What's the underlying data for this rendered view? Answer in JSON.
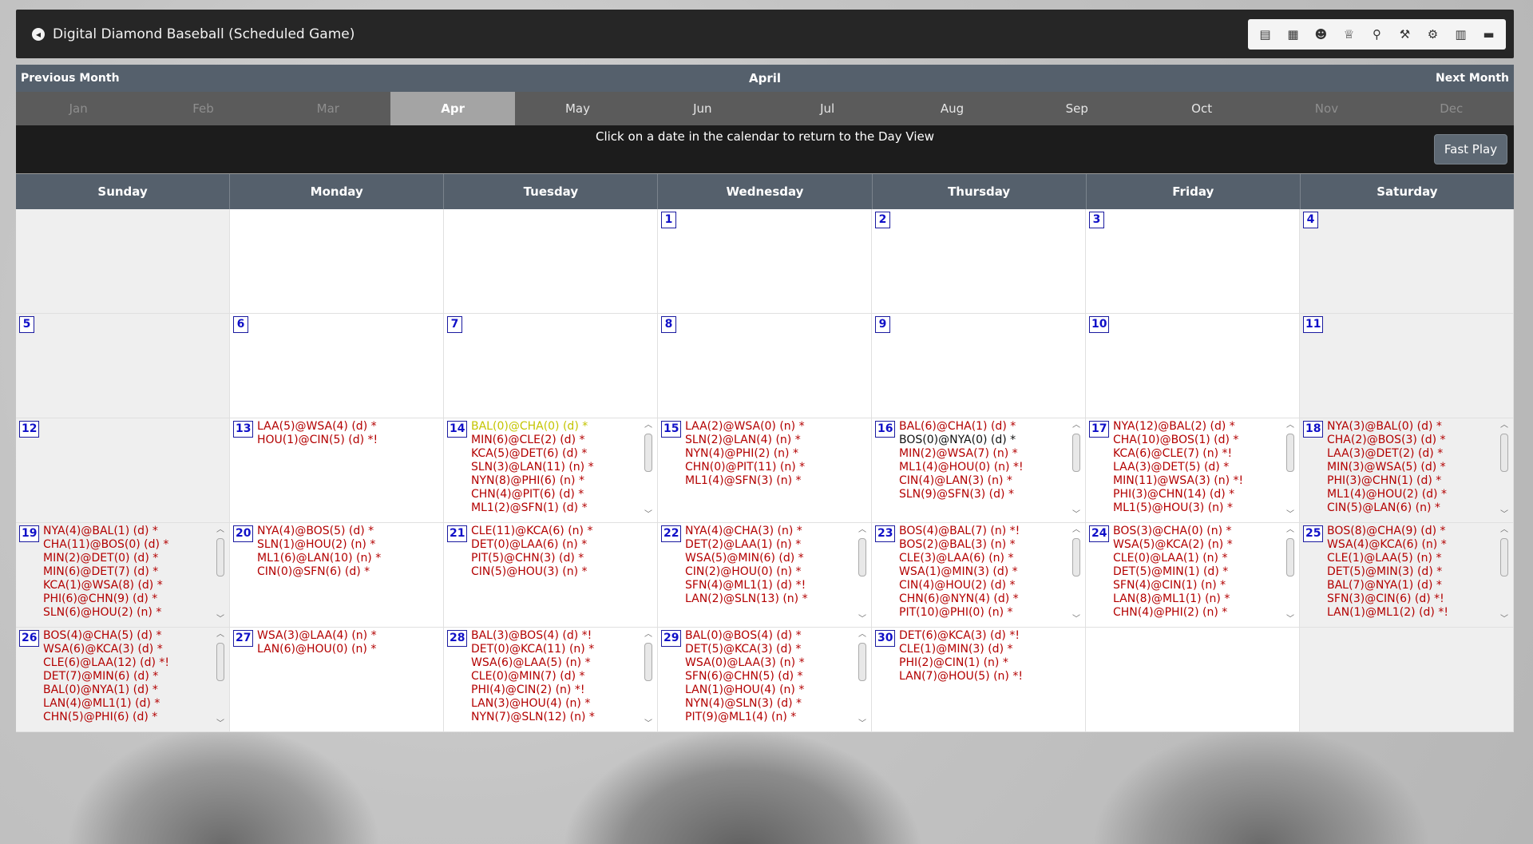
{
  "header": {
    "title": "Digital Diamond Baseball (Scheduled Game)"
  },
  "toolbar": [
    {
      "name": "document-icon",
      "glyph": "▤"
    },
    {
      "name": "grid-icon",
      "glyph": "▦"
    },
    {
      "name": "team-icon",
      "glyph": "☻"
    },
    {
      "name": "trophy-icon",
      "glyph": "♕"
    },
    {
      "name": "search-icon",
      "glyph": "⚲"
    },
    {
      "name": "gavel-icon",
      "glyph": "⚒"
    },
    {
      "name": "gear-icon",
      "glyph": "⚙"
    },
    {
      "name": "clipboard-icon",
      "glyph": "▥"
    },
    {
      "name": "folder-icon",
      "glyph": "▬"
    }
  ],
  "monthbar": {
    "prev": "Previous Month",
    "title": "April",
    "next": "Next Month"
  },
  "months": [
    {
      "label": "Jan",
      "state": "disabled"
    },
    {
      "label": "Feb",
      "state": "disabled"
    },
    {
      "label": "Mar",
      "state": "disabled"
    },
    {
      "label": "Apr",
      "state": "active"
    },
    {
      "label": "May",
      "state": "normal"
    },
    {
      "label": "Jun",
      "state": "normal"
    },
    {
      "label": "Jul",
      "state": "normal"
    },
    {
      "label": "Aug",
      "state": "normal"
    },
    {
      "label": "Sep",
      "state": "normal"
    },
    {
      "label": "Oct",
      "state": "normal"
    },
    {
      "label": "Nov",
      "state": "disabled"
    },
    {
      "label": "Dec",
      "state": "disabled"
    }
  ],
  "info": {
    "text": "Click on a date in the calendar to return to the Day View",
    "fast_play": "Fast Play"
  },
  "daynames": [
    "Sunday",
    "Monday",
    "Tuesday",
    "Wednesday",
    "Thursday",
    "Friday",
    "Saturday"
  ],
  "cells": [
    {
      "day": ""
    },
    {
      "day": ""
    },
    {
      "day": ""
    },
    {
      "day": "1"
    },
    {
      "day": "2"
    },
    {
      "day": "3"
    },
    {
      "day": "4"
    },
    {
      "day": "5"
    },
    {
      "day": "6"
    },
    {
      "day": "7"
    },
    {
      "day": "8"
    },
    {
      "day": "9"
    },
    {
      "day": "10"
    },
    {
      "day": "11"
    },
    {
      "day": "12"
    },
    {
      "day": "13",
      "games": [
        "LAA(5)@WSA(4) (d) *",
        "HOU(1)@CIN(5) (d) *!"
      ]
    },
    {
      "day": "14",
      "scroll": true,
      "games": [
        "BAL(0)@CHA(0) (d) *",
        "MIN(6)@CLE(2) (d) *",
        "KCA(5)@DET(6) (d) *",
        "SLN(3)@LAN(11) (n) *",
        "NYN(8)@PHI(6) (n) *",
        "CHN(4)@PIT(6) (d) *",
        "ML1(2)@SFN(1) (d) *"
      ],
      "styles": {
        "0": "live"
      }
    },
    {
      "day": "15",
      "games": [
        "LAA(2)@WSA(0) (n) *",
        "SLN(2)@LAN(4) (n) *",
        "NYN(4)@PHI(2) (n) *",
        "CHN(0)@PIT(11) (n) *",
        "ML1(4)@SFN(3) (n) *"
      ]
    },
    {
      "day": "16",
      "scroll": true,
      "games": [
        "BAL(6)@CHA(1) (d) *",
        "BOS(0)@NYA(0) (d) *",
        "MIN(2)@WSA(7) (n) *",
        "ML1(4)@HOU(0) (n) *!",
        "CIN(4)@LAN(3) (n) *",
        "SLN(9)@SFN(3) (d) *"
      ],
      "styles": {
        "1": "final"
      }
    },
    {
      "day": "17",
      "scroll": true,
      "games": [
        "NYA(12)@BAL(2) (d) *",
        "CHA(10)@BOS(1) (d) *",
        "KCA(6)@CLE(7) (n) *!",
        "LAA(3)@DET(5) (d) *",
        "MIN(11)@WSA(3) (n) *!",
        "PHI(3)@CHN(14) (d) *",
        "ML1(5)@HOU(3) (n) *"
      ]
    },
    {
      "day": "18",
      "scroll": true,
      "games": [
        "NYA(3)@BAL(0) (d) *",
        "CHA(2)@BOS(3) (d) *",
        "LAA(3)@DET(2) (d) *",
        "MIN(3)@WSA(5) (d) *",
        "PHI(3)@CHN(1) (d) *",
        "ML1(4)@HOU(2) (d) *",
        "CIN(5)@LAN(6) (n) *"
      ]
    },
    {
      "day": "19",
      "scroll": true,
      "games": [
        "NYA(4)@BAL(1) (d) *",
        "CHA(11)@BOS(0) (d) *",
        "MIN(2)@DET(0) (d) *",
        "MIN(6)@DET(7) (d) *",
        "KCA(1)@WSA(8) (d) *",
        "PHI(6)@CHN(9) (d) *",
        "SLN(6)@HOU(2) (n) *"
      ]
    },
    {
      "day": "20",
      "games": [
        "NYA(4)@BOS(5) (d) *",
        "SLN(1)@HOU(2) (n) *",
        "ML1(6)@LAN(10) (n) *",
        "CIN(0)@SFN(6) (d) *"
      ]
    },
    {
      "day": "21",
      "games": [
        "CLE(11)@KCA(6) (n) *",
        "DET(0)@LAA(6) (n) *",
        "PIT(5)@CHN(3) (d) *",
        "CIN(5)@HOU(3) (n) *"
      ]
    },
    {
      "day": "22",
      "scroll": true,
      "games": [
        "NYA(4)@CHA(3) (n) *",
        "DET(2)@LAA(1) (n) *",
        "WSA(5)@MIN(6) (d) *",
        "CIN(2)@HOU(0) (n) *",
        "SFN(4)@ML1(1) (d) *!",
        "LAN(2)@SLN(13) (n) *"
      ]
    },
    {
      "day": "23",
      "scroll": true,
      "games": [
        "BOS(4)@BAL(7) (n) *!",
        "BOS(2)@BAL(3) (n) *",
        "CLE(3)@LAA(6) (n) *",
        "WSA(1)@MIN(3) (d) *",
        "CIN(4)@HOU(2) (d) *",
        "CHN(6)@NYN(4) (d) *",
        "PIT(10)@PHI(0) (n) *"
      ]
    },
    {
      "day": "24",
      "scroll": true,
      "games": [
        "BOS(3)@CHA(0) (n) *",
        "WSA(5)@KCA(2) (n) *",
        "CLE(0)@LAA(1) (n) *",
        "DET(5)@MIN(1) (d) *",
        "SFN(4)@CIN(1) (n) *",
        "LAN(8)@ML1(1) (n) *",
        "CHN(4)@PHI(2) (n) *"
      ]
    },
    {
      "day": "25",
      "scroll": true,
      "games": [
        "BOS(8)@CHA(9) (d) *",
        "WSA(4)@KCA(6) (n) *",
        "CLE(1)@LAA(5) (n) *",
        "DET(5)@MIN(3) (d) *",
        "BAL(7)@NYA(1) (d) *",
        "SFN(3)@CIN(6) (d) *!",
        "LAN(1)@ML1(2) (d) *!"
      ]
    },
    {
      "day": "26",
      "scroll": true,
      "games": [
        "BOS(4)@CHA(5) (d) *",
        "WSA(6)@KCA(3) (d) *",
        "CLE(6)@LAA(12) (d) *!",
        "DET(7)@MIN(6) (d) *",
        "BAL(0)@NYA(1) (d) *",
        "LAN(4)@ML1(1) (d) *",
        "CHN(5)@PHI(6) (d) *"
      ]
    },
    {
      "day": "27",
      "games": [
        "WSA(3)@LAA(4) (n) *",
        "LAN(6)@HOU(0) (n) *"
      ]
    },
    {
      "day": "28",
      "scroll": true,
      "games": [
        "BAL(3)@BOS(4) (d) *!",
        "DET(0)@KCA(11) (n) *",
        "WSA(6)@LAA(5) (n) *",
        "CLE(0)@MIN(7) (d) *",
        "PHI(4)@CIN(2) (n) *!",
        "LAN(3)@HOU(4) (n) *",
        "NYN(7)@SLN(12) (n) *"
      ]
    },
    {
      "day": "29",
      "scroll": true,
      "games": [
        "BAL(0)@BOS(4) (d) *",
        "DET(5)@KCA(3) (d) *",
        "WSA(0)@LAA(3) (n) *",
        "SFN(6)@CHN(5) (d) *",
        "LAN(1)@HOU(4) (n) *",
        "NYN(4)@SLN(3) (d) *",
        "PIT(9)@ML1(4) (n) *"
      ]
    },
    {
      "day": "30",
      "games": [
        "DET(6)@KCA(3) (d) *!",
        "CLE(1)@MIN(3) (d) *",
        "PHI(2)@CIN(1) (n) *",
        "LAN(7)@HOU(5) (n) *!"
      ]
    },
    {
      "day": ""
    },
    {
      "day": ""
    }
  ]
}
